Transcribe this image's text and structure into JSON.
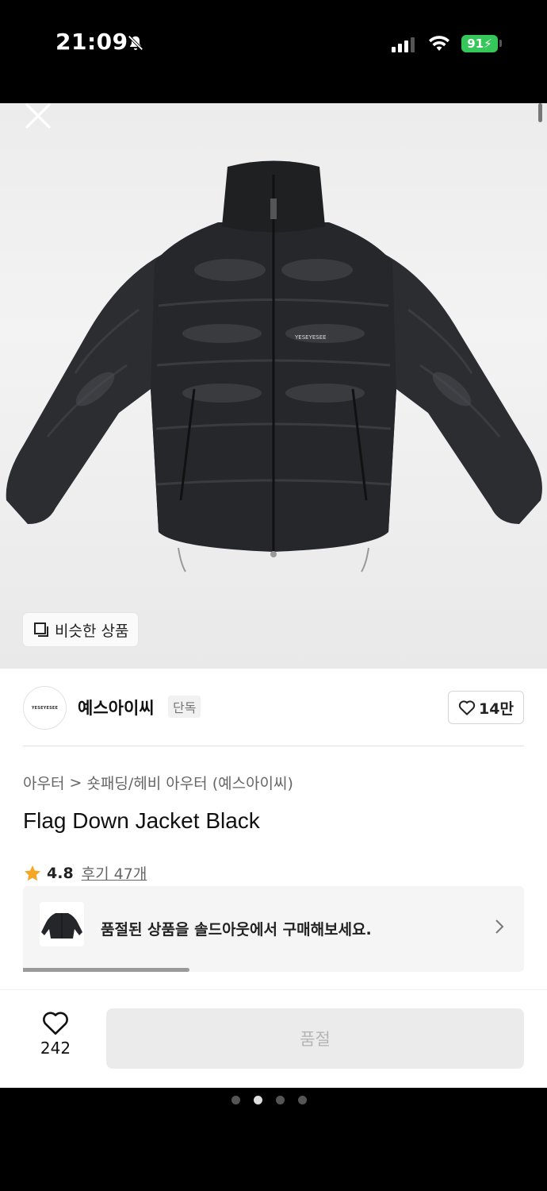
{
  "status_bar": {
    "time": "21:09",
    "battery": "91"
  },
  "hero": {
    "similar_label": "비슷한 상품",
    "jacket_logo_text": "YESEYESEE"
  },
  "brand": {
    "logo_text": "YESEYESEE",
    "name": "예스아이씨",
    "tag": "단독",
    "likes": "14만"
  },
  "breadcrumb": {
    "level1": "아우터",
    "separator": ">",
    "level2": "숏패딩/헤비 아우터 (예스아이씨)"
  },
  "product": {
    "title": "Flag Down Jacket Black",
    "rating": "4.8",
    "reviews": "후기 47개"
  },
  "soldout_banner": {
    "text": "품절된 상품을 솔드아웃에서 구매해보세요."
  },
  "bottom_actions": {
    "wish_count": "242",
    "buy_label": "품절"
  },
  "pager": {
    "total": 4,
    "active_index": 1
  },
  "colors": {
    "battery_green": "#35c759",
    "star": "#f5a623",
    "disabled_button_bg": "#ebebeb",
    "disabled_button_text": "#b5b5b5"
  },
  "icons": [
    "bell-slash-icon",
    "signal-icon",
    "wifi-icon",
    "battery-icon",
    "close-icon",
    "similar-items-icon",
    "heart-icon",
    "star-icon",
    "chevron-right-icon"
  ]
}
